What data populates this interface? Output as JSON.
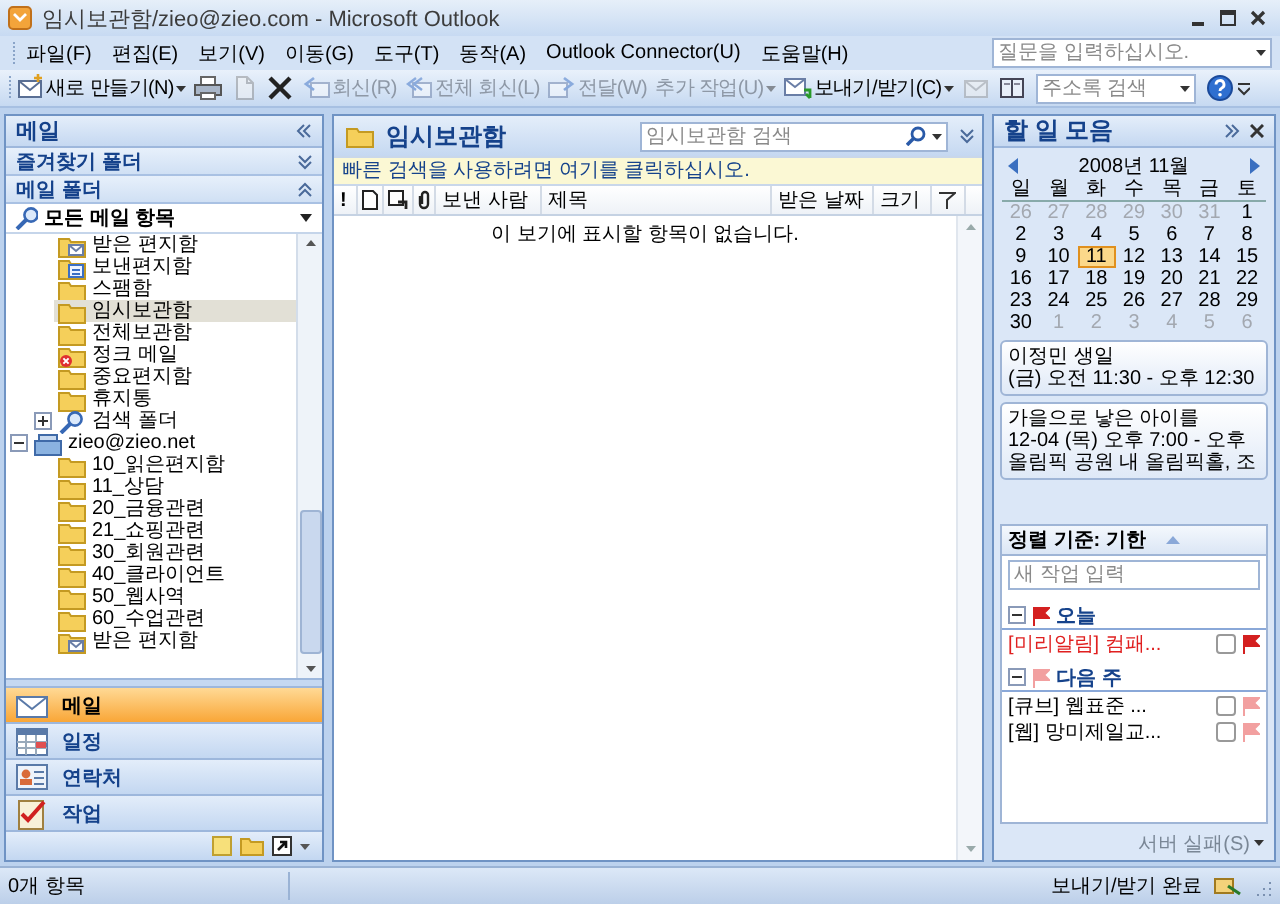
{
  "window": {
    "title": "임시보관함/zieo@zieo.com - Microsoft Outlook"
  },
  "menu": [
    "파일(F)",
    "편집(E)",
    "보기(V)",
    "이동(G)",
    "도구(T)",
    "동작(A)",
    "Outlook Connector(U)",
    "도움말(H)"
  ],
  "help_box": {
    "placeholder": "질문을 입력하십시오."
  },
  "toolbar": [
    {
      "kind": "new",
      "label": "새로 만들기(N)",
      "disabled": false,
      "dropdown": true
    },
    {
      "kind": "print",
      "disabled": false,
      "dropdown": false
    },
    {
      "kind": "move",
      "disabled": true,
      "dropdown": false
    },
    {
      "kind": "delete",
      "disabled": false,
      "dropdown": false
    },
    {
      "kind": "reply",
      "label": "회신(R)",
      "disabled": true,
      "dropdown": false
    },
    {
      "kind": "reply-all",
      "label": "전체 회신(L)",
      "disabled": true,
      "dropdown": false
    },
    {
      "kind": "forward",
      "label": "전달(W)",
      "disabled": true,
      "dropdown": false
    },
    {
      "kind": "more",
      "label": "추가 작업(U)",
      "disabled": true,
      "dropdown": true
    },
    {
      "kind": "send-receive",
      "label": "보내기/받기(C)",
      "disabled": false,
      "dropdown": true
    },
    {
      "kind": "contact",
      "disabled": true,
      "dropdown": false
    },
    {
      "kind": "address-book",
      "disabled": false,
      "dropdown": false
    },
    {
      "kind": "search-field",
      "placeholder": "주소록 검색"
    },
    {
      "kind": "help",
      "disabled": false,
      "dropdown": false
    }
  ],
  "mail_pane": {
    "title": "메일",
    "sections": [
      {
        "label": "즐겨찾기 폴더",
        "expanded": false
      },
      {
        "label": "메일 폴더",
        "expanded": true
      }
    ],
    "view_selector": "모든 메일 항목",
    "folder_tree": [
      {
        "children": [
          {
            "label": "받은 편지함",
            "kind": "inbox",
            "selected": false
          },
          {
            "label": "보낸편지함",
            "kind": "sent",
            "selected": false
          },
          {
            "label": "스팸함",
            "kind": "folder",
            "selected": false
          },
          {
            "label": "임시보관함",
            "kind": "folder",
            "selected": true
          },
          {
            "label": "전체보관함",
            "kind": "folder",
            "selected": false
          },
          {
            "label": "정크 메일",
            "kind": "junk",
            "selected": false
          },
          {
            "label": "중요편지함",
            "kind": "folder",
            "selected": false
          },
          {
            "label": "휴지통",
            "kind": "folder",
            "selected": false
          },
          {
            "label": "검색 폴더",
            "kind": "search",
            "selected": false,
            "expanded": false
          }
        ]
      },
      {
        "label": "zieo@zieo.net",
        "kind": "account",
        "selected": false,
        "expanded": true,
        "children": [
          {
            "label": "10_읽은편지함",
            "kind": "folder",
            "selected": false
          },
          {
            "label": "11_상담",
            "kind": "folder",
            "selected": false
          },
          {
            "label": "20_금융관련",
            "kind": "folder",
            "selected": false
          },
          {
            "label": "21_쇼핑관련",
            "kind": "folder",
            "selected": false
          },
          {
            "label": "30_회원관련",
            "kind": "folder",
            "selected": false
          },
          {
            "label": "40_클라이언트",
            "kind": "folder",
            "selected": false
          },
          {
            "label": "50_웹사역",
            "kind": "folder",
            "selected": false
          },
          {
            "label": "60_수업관련",
            "kind": "folder",
            "selected": false
          },
          {
            "label": "받은 편지함",
            "kind": "inbox",
            "selected": false
          }
        ]
      }
    ],
    "nav_buttons": [
      {
        "kind": "mail",
        "label": "메일",
        "selected": true
      },
      {
        "kind": "calendar",
        "label": "일정",
        "selected": false
      },
      {
        "kind": "contacts",
        "label": "연락처",
        "selected": false
      },
      {
        "kind": "tasks",
        "label": "작업",
        "selected": false
      }
    ]
  },
  "folder_view": {
    "title": "임시보관함",
    "search": {
      "placeholder": "임시보관함 검색"
    },
    "quick_search_hint": "빠른 검색을 사용하려면 여기를 클릭하십시오.",
    "columns": [
      {
        "kind": "importance",
        "label": "!"
      },
      {
        "kind": "item-icon"
      },
      {
        "kind": "reminder-icon"
      },
      {
        "kind": "attachment-icon"
      },
      {
        "kind": "from",
        "label": "보낸 사람"
      },
      {
        "kind": "subject",
        "label": "제목"
      },
      {
        "kind": "date",
        "label": "받은 날짜"
      },
      {
        "kind": "size",
        "label": "크기"
      },
      {
        "kind": "flag-icon"
      }
    ],
    "empty_message": "이 보기에 표시할 항목이 없습니다."
  },
  "todo_bar": {
    "title": "할 일 모음",
    "calendar": {
      "month": "2008년 11월",
      "weekdays": [
        "일",
        "월",
        "화",
        "수",
        "목",
        "금",
        "토"
      ],
      "weeks": [
        [
          {
            "day": "26",
            "other_month": true,
            "selected": false
          },
          {
            "day": "27",
            "other_month": true,
            "selected": false
          },
          {
            "day": "28",
            "other_month": true,
            "selected": false
          },
          {
            "day": "29",
            "other_month": true,
            "selected": false
          },
          {
            "day": "30",
            "other_month": true,
            "selected": false
          },
          {
            "day": "31",
            "other_month": true,
            "selected": false
          },
          {
            "day": "1",
            "other_month": false,
            "selected": false
          }
        ],
        [
          {
            "day": "2",
            "other_month": false,
            "selected": false
          },
          {
            "day": "3",
            "other_month": false,
            "selected": false
          },
          {
            "day": "4",
            "other_month": false,
            "selected": false
          },
          {
            "day": "5",
            "other_month": false,
            "selected": false
          },
          {
            "day": "6",
            "other_month": false,
            "selected": false
          },
          {
            "day": "7",
            "other_month": false,
            "selected": false
          },
          {
            "day": "8",
            "other_month": false,
            "selected": false
          }
        ],
        [
          {
            "day": "9",
            "other_month": false,
            "selected": false
          },
          {
            "day": "10",
            "other_month": false,
            "selected": false
          },
          {
            "day": "11",
            "other_month": false,
            "selected": true
          },
          {
            "day": "12",
            "other_month": false,
            "selected": false
          },
          {
            "day": "13",
            "other_month": false,
            "selected": false
          },
          {
            "day": "14",
            "other_month": false,
            "selected": false
          },
          {
            "day": "15",
            "other_month": false,
            "selected": false
          }
        ],
        [
          {
            "day": "16",
            "other_month": false,
            "selected": false
          },
          {
            "day": "17",
            "other_month": false,
            "selected": false
          },
          {
            "day": "18",
            "other_month": false,
            "selected": false
          },
          {
            "day": "19",
            "other_month": false,
            "selected": false
          },
          {
            "day": "20",
            "other_month": false,
            "selected": false
          },
          {
            "day": "21",
            "other_month": false,
            "selected": false
          },
          {
            "day": "22",
            "other_month": false,
            "selected": false
          }
        ],
        [
          {
            "day": "23",
            "other_month": false,
            "selected": false
          },
          {
            "day": "24",
            "other_month": false,
            "selected": false
          },
          {
            "day": "25",
            "other_month": false,
            "selected": false
          },
          {
            "day": "26",
            "other_month": false,
            "selected": false
          },
          {
            "day": "27",
            "other_month": false,
            "selected": false
          },
          {
            "day": "28",
            "other_month": false,
            "selected": false
          },
          {
            "day": "29",
            "other_month": false,
            "selected": false
          }
        ],
        [
          {
            "day": "30",
            "other_month": false,
            "selected": false
          },
          {
            "day": "1",
            "other_month": true,
            "selected": false
          },
          {
            "day": "2",
            "other_month": true,
            "selected": false
          },
          {
            "day": "3",
            "other_month": true,
            "selected": false
          },
          {
            "day": "4",
            "other_month": true,
            "selected": false
          },
          {
            "day": "5",
            "other_month": true,
            "selected": false
          },
          {
            "day": "6",
            "other_month": true,
            "selected": false
          }
        ]
      ]
    },
    "appointments": [
      {
        "title": "이정민 생일",
        "lines": [
          "(금) 오전 11:30 - 오후 12:30"
        ]
      },
      {
        "title": "가을으로 낳은 아이를",
        "lines": [
          "12-04 (목) 오후 7:00 - 오후",
          "올림픽 공원 내 올림픽홀, 조"
        ]
      }
    ],
    "tasks": {
      "sort_label": "정렬 기준: 기한",
      "new_task": {
        "placeholder": "새 작업 입력"
      },
      "groups": [
        {
          "label": "오늘",
          "expanded": true,
          "color": "#d42020",
          "items": [
            {
              "label": "[미리알림] 컴패...",
              "overdue": true,
              "checked": false,
              "color": "#d42020"
            }
          ]
        },
        {
          "label": "다음 주",
          "expanded": true,
          "color": "#f2a0a0",
          "items": [
            {
              "label": "[큐브] 웹표준 ...",
              "overdue": false,
              "checked": false,
              "color": "#f2a0a0"
            },
            {
              "label": "[웹] 망미제일교...",
              "overdue": false,
              "checked": false,
              "color": "#f2a0a0"
            }
          ]
        }
      ]
    },
    "server_button": "서버 실패(S)"
  },
  "status_bar": {
    "count": "0개 항목",
    "sync": "보내기/받기 완료"
  }
}
